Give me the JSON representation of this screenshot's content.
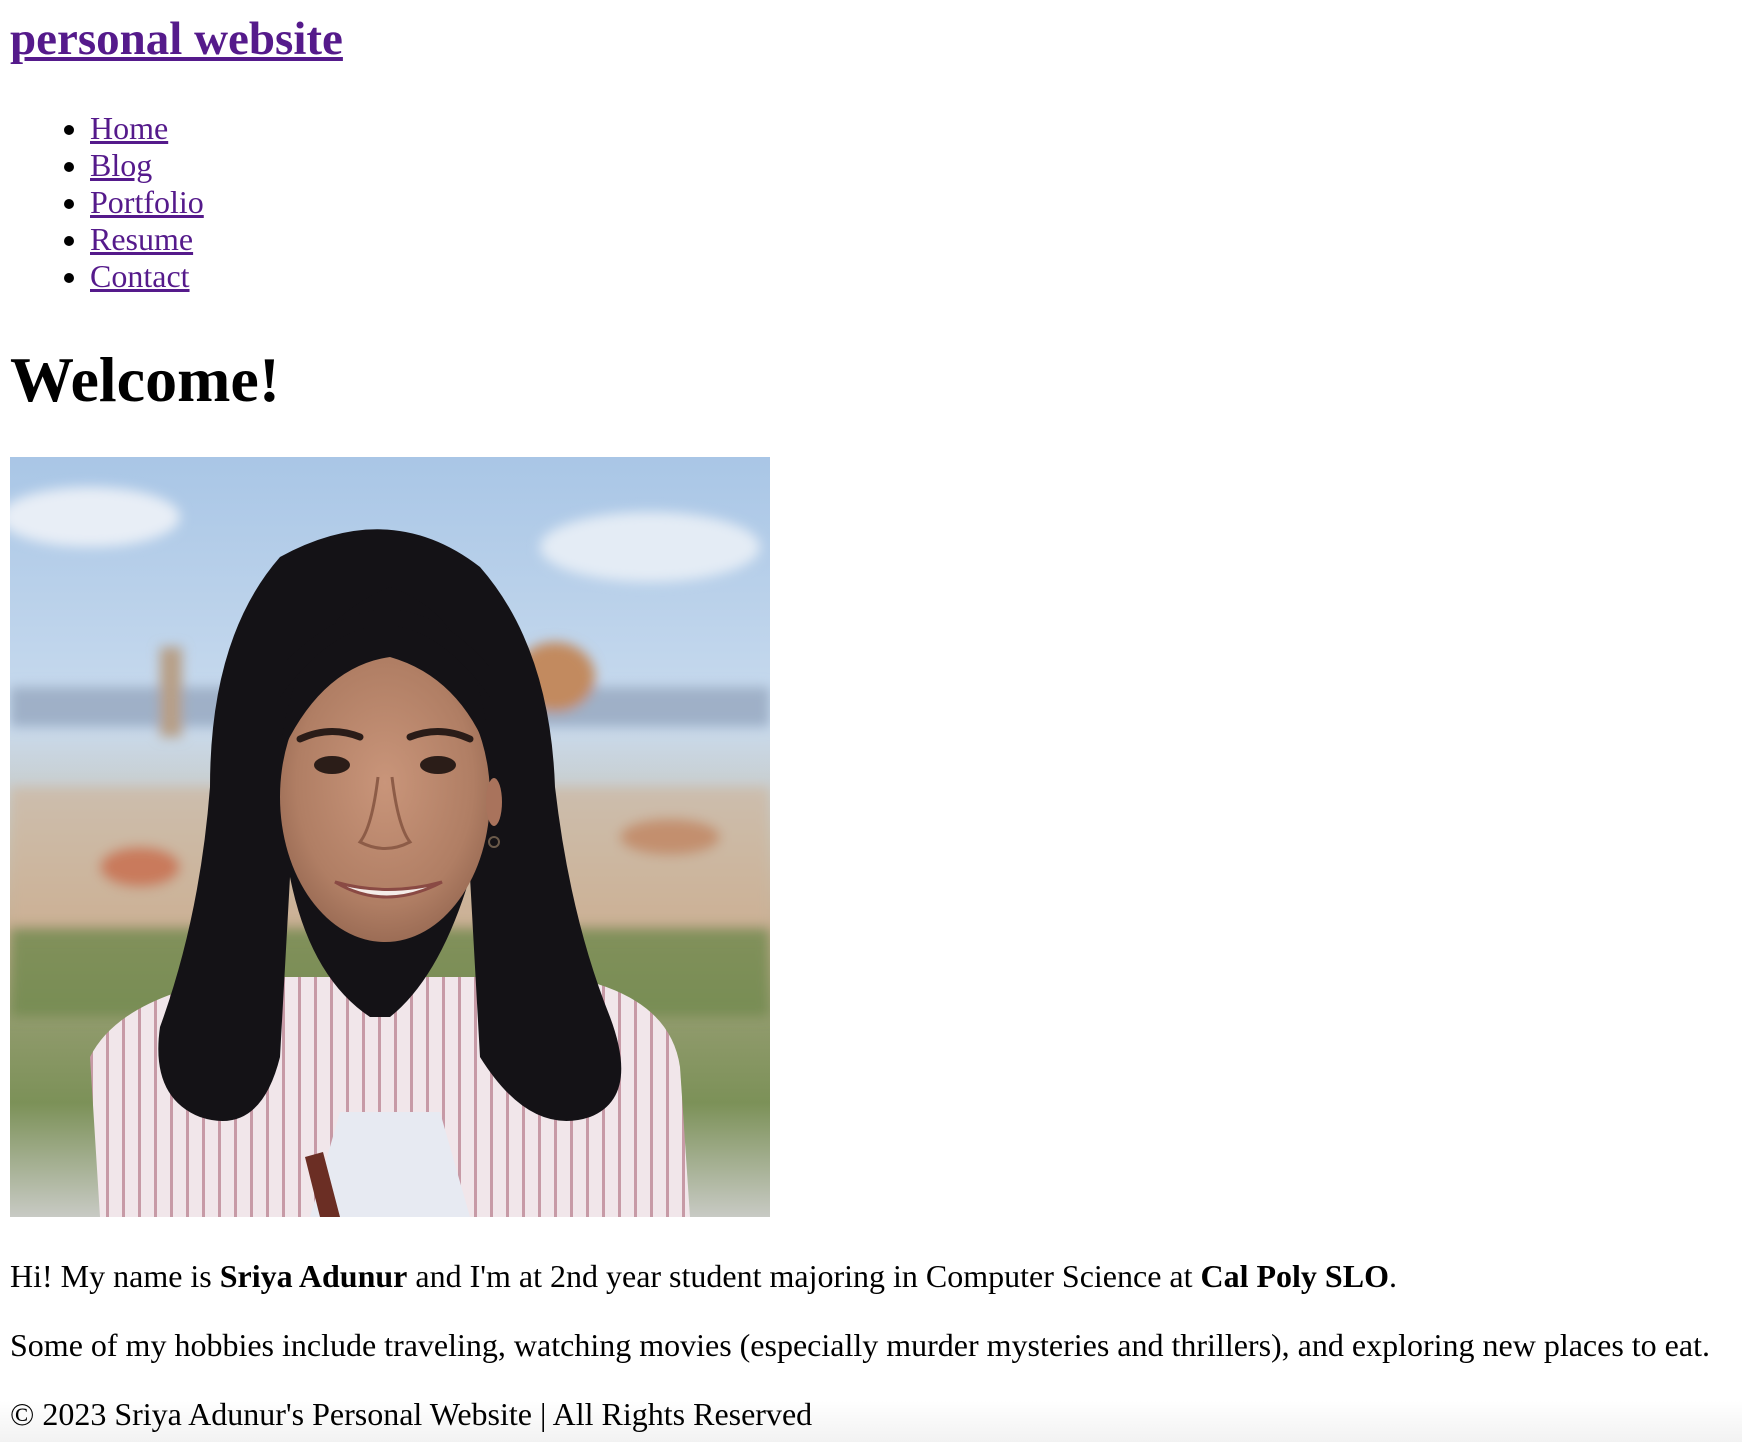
{
  "header": {
    "site_title": "personal website"
  },
  "nav": {
    "items": [
      {
        "label": "Home"
      },
      {
        "label": "Blog"
      },
      {
        "label": "Portfolio"
      },
      {
        "label": "Resume"
      },
      {
        "label": "Contact"
      }
    ]
  },
  "main": {
    "heading": "Welcome!",
    "intro": {
      "part1": "Hi! My name is ",
      "name": "Sriya Adunur",
      "part2": " and I'm at 2nd year student majoring in Computer Science at ",
      "school": "Cal Poly SLO",
      "part3": "."
    },
    "hobbies": "Some of my hobbies include traveling, watching movies (especially murder mysteries and thrillers), and exploring new places to eat."
  },
  "footer": {
    "text": "© 2023 Sriya Adunur's Personal Website | All Rights Reserved"
  },
  "colors": {
    "link": "#551A8B",
    "text": "#000000",
    "background": "#ffffff"
  }
}
